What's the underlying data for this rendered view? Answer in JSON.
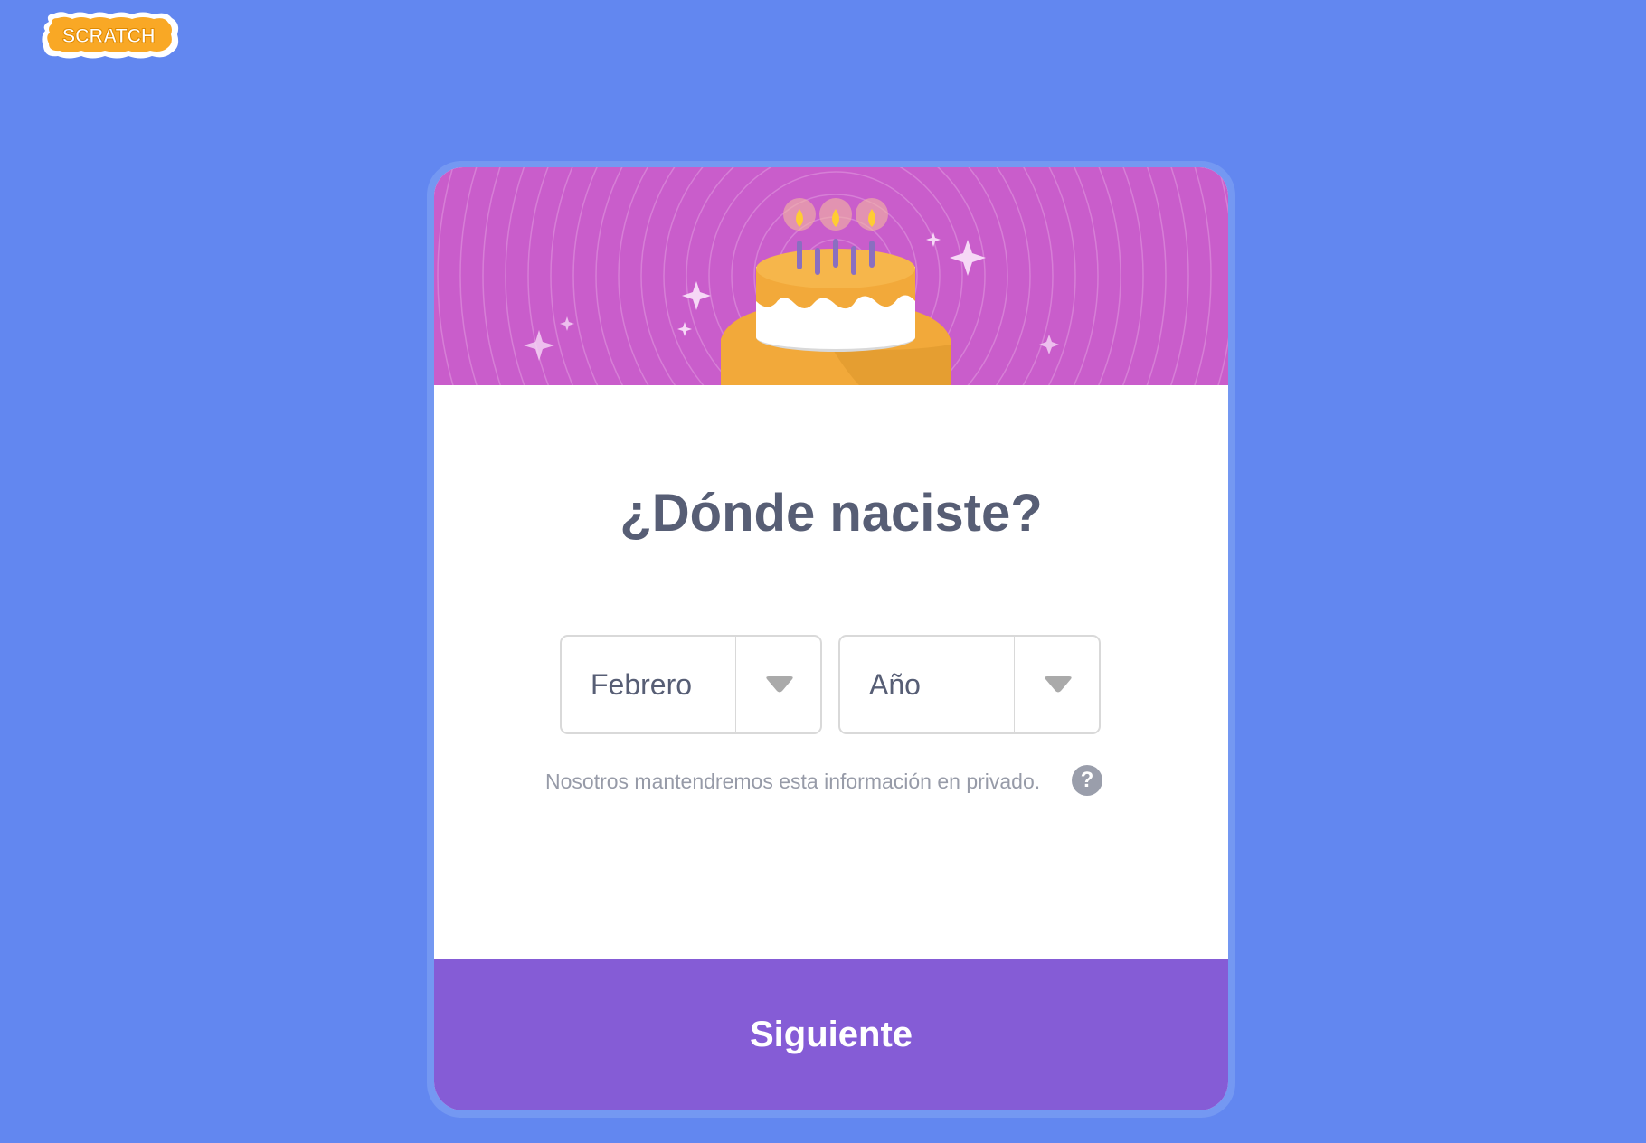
{
  "header": {
    "logo_text": "SCRATCH",
    "logo_icon": "scratch-logo"
  },
  "colors": {
    "background": "#6287f0",
    "banner": "#c95dcb",
    "cake": "#f6aa3a",
    "button": "#855cd6",
    "title_text": "#575e75",
    "hint_text": "#979ba8"
  },
  "dialog": {
    "banner_icon": "birthday-cake-illustration",
    "title": "¿Dónde naciste?",
    "month_select": {
      "value": "Febrero",
      "icon": "chevron-down-icon"
    },
    "year_select": {
      "value": "Año",
      "icon": "chevron-down-icon"
    },
    "privacy_note": "Nosotros mantendremos esta información en privado.",
    "help_icon_glyph": "?",
    "next_label": "Siguiente"
  }
}
